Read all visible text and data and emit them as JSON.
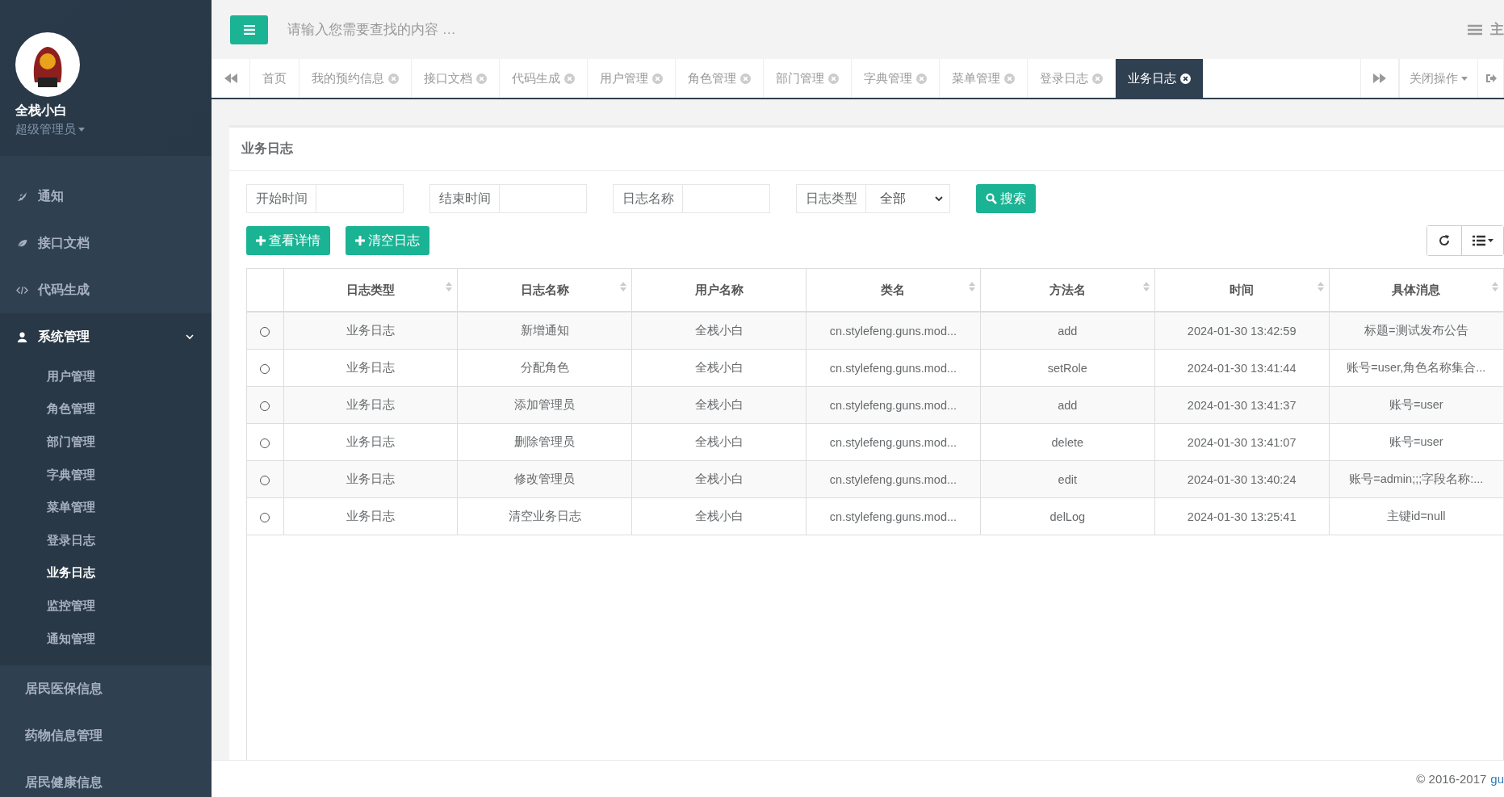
{
  "sidebar": {
    "user": {
      "name": "全栈小白",
      "role": "超级管理员"
    },
    "menu": [
      {
        "label": "通知"
      },
      {
        "label": "接口文档"
      },
      {
        "label": "代码生成"
      },
      {
        "label": "系统管理",
        "expanded": true,
        "children": [
          {
            "label": "用户管理",
            "selected": false
          },
          {
            "label": "角色管理",
            "selected": false
          },
          {
            "label": "部门管理",
            "selected": false
          },
          {
            "label": "字典管理",
            "selected": false
          },
          {
            "label": "菜单管理",
            "selected": false
          },
          {
            "label": "登录日志",
            "selected": false
          },
          {
            "label": "业务日志",
            "selected": true
          },
          {
            "label": "监控管理",
            "selected": false
          },
          {
            "label": "通知管理",
            "selected": false
          }
        ]
      },
      {
        "label": "居民医保信息"
      },
      {
        "label": "药物信息管理"
      },
      {
        "label": "居民健康信息"
      }
    ]
  },
  "search": {
    "placeholder": "请输入您需要查找的内容 …"
  },
  "top_right_label": "主",
  "tabs": [
    {
      "label": "首页",
      "closable": false,
      "selected": false
    },
    {
      "label": "我的预约信息",
      "closable": true,
      "selected": false
    },
    {
      "label": "接口文档",
      "closable": true,
      "selected": false
    },
    {
      "label": "代码生成",
      "closable": true,
      "selected": false
    },
    {
      "label": "用户管理",
      "closable": true,
      "selected": false
    },
    {
      "label": "角色管理",
      "closable": true,
      "selected": false
    },
    {
      "label": "部门管理",
      "closable": true,
      "selected": false
    },
    {
      "label": "字典管理",
      "closable": true,
      "selected": false
    },
    {
      "label": "菜单管理",
      "closable": true,
      "selected": false
    },
    {
      "label": "登录日志",
      "closable": true,
      "selected": false
    },
    {
      "label": "业务日志",
      "closable": true,
      "selected": true
    }
  ],
  "close_menu": "关闭操作",
  "panel": {
    "title": "业务日志",
    "filters": [
      {
        "label": "开始时间",
        "kind": "input"
      },
      {
        "label": "结束时间",
        "kind": "input"
      },
      {
        "label": "日志名称",
        "kind": "input"
      },
      {
        "label": "日志类型",
        "kind": "select",
        "value": "全部"
      }
    ],
    "search_button": "搜索",
    "actions": [
      "查看详情",
      "清空日志"
    ],
    "table": {
      "columns": [
        {
          "label": "日志类型",
          "sortable": true
        },
        {
          "label": "日志名称",
          "sortable": true
        },
        {
          "label": "用户名称",
          "sortable": false
        },
        {
          "label": "类名",
          "sortable": true
        },
        {
          "label": "方法名",
          "sortable": true
        },
        {
          "label": "时间",
          "sortable": true
        },
        {
          "label": "具体消息",
          "sortable": true
        }
      ],
      "rows": [
        {
          "selected": false,
          "cells": [
            "业务日志",
            "新增通知",
            "全栈小白",
            "cn.stylefeng.guns.mod...",
            "add",
            "2024-01-30 13:42:59",
            "标题=测试发布公告"
          ]
        },
        {
          "selected": false,
          "cells": [
            "业务日志",
            "分配角色",
            "全栈小白",
            "cn.stylefeng.guns.mod...",
            "setRole",
            "2024-01-30 13:41:44",
            "账号=user,角色名称集合..."
          ]
        },
        {
          "selected": false,
          "cells": [
            "业务日志",
            "添加管理员",
            "全栈小白",
            "cn.stylefeng.guns.mod...",
            "add",
            "2024-01-30 13:41:37",
            "账号=user"
          ]
        },
        {
          "selected": false,
          "cells": [
            "业务日志",
            "删除管理员",
            "全栈小白",
            "cn.stylefeng.guns.mod...",
            "delete",
            "2024-01-30 13:41:07",
            "账号=user"
          ]
        },
        {
          "selected": false,
          "cells": [
            "业务日志",
            "修改管理员",
            "全栈小白",
            "cn.stylefeng.guns.mod...",
            "edit",
            "2024-01-30 13:40:24",
            "账号=admin;;;字段名称:..."
          ]
        },
        {
          "selected": false,
          "cells": [
            "业务日志",
            "清空业务日志",
            "全栈小白",
            "cn.stylefeng.guns.mod...",
            "delLog",
            "2024-01-30 13:25:41",
            "主键id=null"
          ]
        }
      ]
    }
  },
  "footer": {
    "copyright": "© 2016-2017",
    "link": "gu"
  }
}
